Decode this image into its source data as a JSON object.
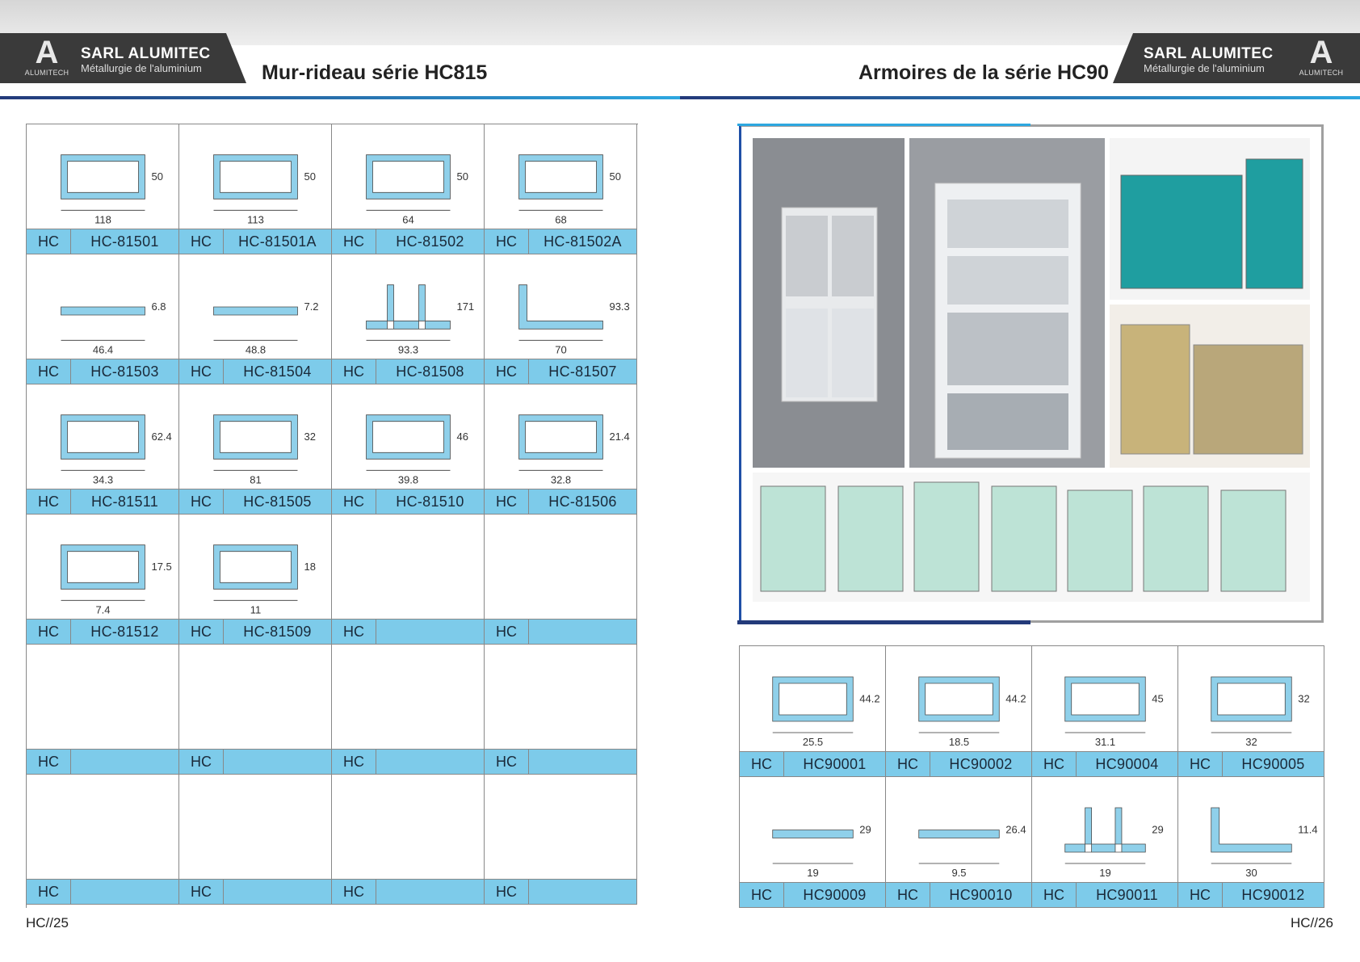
{
  "header": {
    "company_name": "SARL ALUMITEC",
    "company_tagline": "Métallurgie de l'aluminium",
    "logo_subtext": "ALUMITECH",
    "logo_letter": "A",
    "left_title": "Mur-rideau série HC815",
    "right_title": "Armoires de la série HC90"
  },
  "left_table": {
    "rows": [
      [
        {
          "prefix": "HC",
          "code": "HC-81501",
          "dims": [
            "118",
            "50"
          ]
        },
        {
          "prefix": "HC",
          "code": "HC-81501A",
          "dims": [
            "113",
            "50"
          ]
        },
        {
          "prefix": "HC",
          "code": "HC-81502",
          "dims": [
            "64",
            "50"
          ]
        },
        {
          "prefix": "HC",
          "code": "HC-81502A",
          "dims": [
            "68",
            "50"
          ]
        }
      ],
      [
        {
          "prefix": "HC",
          "code": "HC-81503",
          "dims": [
            "46.4",
            "6.8"
          ]
        },
        {
          "prefix": "HC",
          "code": "HC-81504",
          "dims": [
            "48.8",
            "7.2"
          ]
        },
        {
          "prefix": "HC",
          "code": "HC-81508",
          "dims": [
            "93.3",
            "171"
          ]
        },
        {
          "prefix": "HC",
          "code": "HC-81507",
          "dims": [
            "70",
            "93.3"
          ]
        }
      ],
      [
        {
          "prefix": "HC",
          "code": "HC-81511",
          "dims": [
            "34.3",
            "62.4"
          ]
        },
        {
          "prefix": "HC",
          "code": "HC-81505",
          "dims": [
            "81",
            "32"
          ]
        },
        {
          "prefix": "HC",
          "code": "HC-81510",
          "dims": [
            "39.8",
            "46"
          ]
        },
        {
          "prefix": "HC",
          "code": "HC-81506",
          "dims": [
            "32.8",
            "21.4"
          ]
        }
      ],
      [
        {
          "prefix": "HC",
          "code": "HC-81512",
          "dims": [
            "7.4",
            "17.5"
          ]
        },
        {
          "prefix": "HC",
          "code": "HC-81509",
          "dims": [
            "11",
            "18"
          ]
        },
        {
          "prefix": "HC",
          "code": "",
          "dims": []
        },
        {
          "prefix": "HC",
          "code": "",
          "dims": []
        }
      ],
      [
        {
          "prefix": "HC",
          "code": "",
          "dims": []
        },
        {
          "prefix": "HC",
          "code": "",
          "dims": []
        },
        {
          "prefix": "HC",
          "code": "",
          "dims": []
        },
        {
          "prefix": "HC",
          "code": "",
          "dims": []
        }
      ],
      [
        {
          "prefix": "HC",
          "code": "",
          "dims": []
        },
        {
          "prefix": "HC",
          "code": "",
          "dims": []
        },
        {
          "prefix": "HC",
          "code": "",
          "dims": []
        },
        {
          "prefix": "HC",
          "code": "",
          "dims": []
        }
      ]
    ]
  },
  "right_table": {
    "rows": [
      [
        {
          "prefix": "HC",
          "code": "HC90001",
          "dims": [
            "25.5",
            "44.2"
          ]
        },
        {
          "prefix": "HC",
          "code": "HC90002",
          "dims": [
            "18.5",
            "44.2"
          ]
        },
        {
          "prefix": "HC",
          "code": "HC90004",
          "dims": [
            "31.1",
            "45"
          ]
        },
        {
          "prefix": "HC",
          "code": "HC90005",
          "dims": [
            "32",
            "32"
          ]
        }
      ],
      [
        {
          "prefix": "HC",
          "code": "HC90009",
          "dims": [
            "19",
            "29"
          ]
        },
        {
          "prefix": "HC",
          "code": "HC90010",
          "dims": [
            "9.5",
            "26.4"
          ]
        },
        {
          "prefix": "HC",
          "code": "HC90011",
          "dims": [
            "19",
            "29"
          ]
        },
        {
          "prefix": "HC",
          "code": "HC90012",
          "dims": [
            "30",
            "11.4"
          ]
        }
      ]
    ]
  },
  "colors": {
    "accent_blue": "#7dcbea",
    "profile_blue": "#8fd0ea",
    "dark": "#3a3a3a",
    "cabinet_teal": "#1f9ea0",
    "cabinet_gold": "#c8b37a"
  },
  "footer": {
    "left_page": "HC//25",
    "right_page": "HC//26"
  }
}
